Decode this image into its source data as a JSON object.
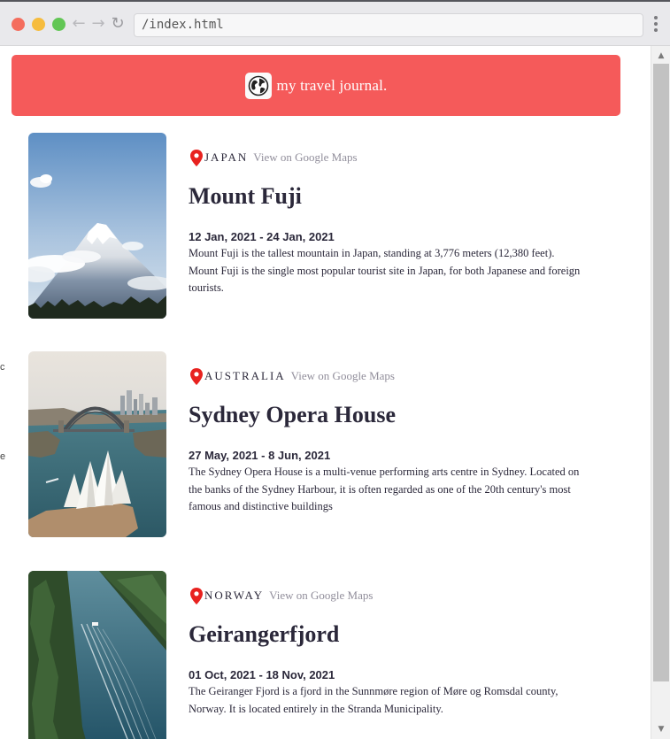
{
  "browser": {
    "url": "/index.html",
    "back_icon": "←",
    "forward_icon": "→",
    "reload_icon": "↻"
  },
  "header": {
    "icon": "globe-icon",
    "title": "my travel journal."
  },
  "colors": {
    "header_bg": "#F55A5A",
    "pin": "#F55A5A",
    "text": "#2B283A",
    "link": "#918E9B"
  },
  "entries": [
    {
      "country": "JAPAN",
      "maps_link": "View on Google Maps",
      "title": "Mount Fuji",
      "dates": "12 Jan, 2021 - 24 Jan, 2021",
      "description": "Mount Fuji is the tallest mountain in Japan, standing at 3,776 meters (12,380 feet). Mount Fuji is the single most popular tourist site in Japan, for both Japanese and foreign tourists."
    },
    {
      "country": "AUSTRALIA",
      "maps_link": "View on Google Maps",
      "title": "Sydney Opera House",
      "dates": "27 May, 2021 - 8 Jun, 2021",
      "description": "The Sydney Opera House is a multi-venue performing arts centre in Sydney. Located on the banks of the Sydney Harbour, it is often regarded as one of the 20th century's most famous and distinctive buildings"
    },
    {
      "country": "NORWAY",
      "maps_link": "View on Google Maps",
      "title": "Geirangerfjord",
      "dates": "01 Oct, 2021 - 18 Nov, 2021",
      "description": "The Geiranger Fjord is a fjord in the Sunnmøre region of Møre og Romsdal county, Norway. It is located entirely in the Stranda Municipality."
    }
  ]
}
